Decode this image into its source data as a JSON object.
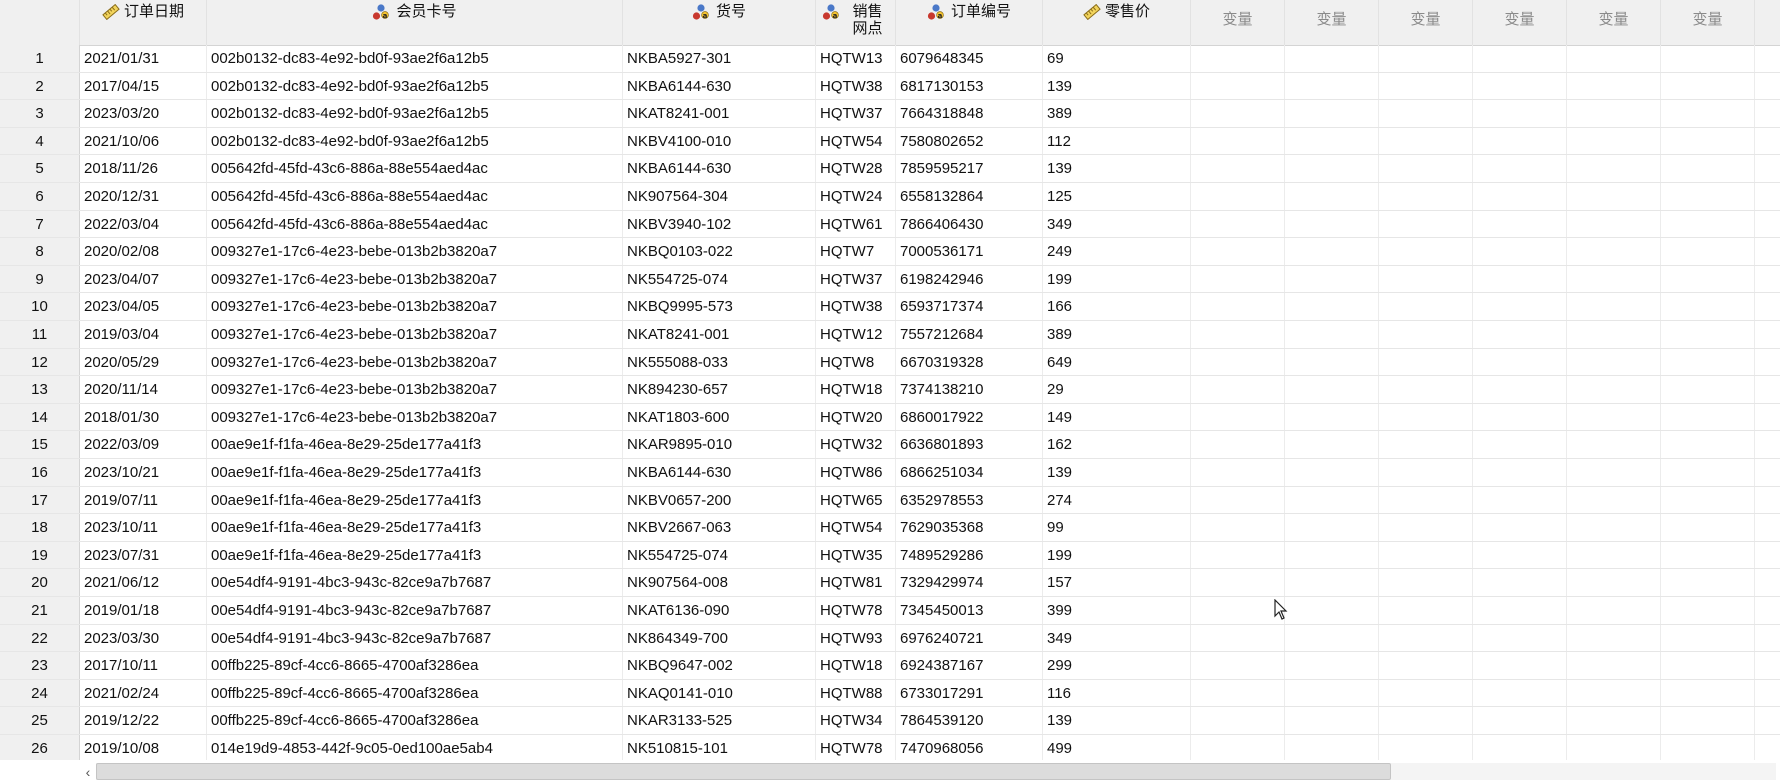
{
  "columns": [
    {
      "label": "订单日期",
      "icon": "ruler-icon"
    },
    {
      "label": "会员卡号",
      "icon": "nominal-string-icon"
    },
    {
      "label": "货号",
      "icon": "nominal-string-icon"
    },
    {
      "label": "销售网点",
      "icon": "nominal-string-icon"
    },
    {
      "label": "订单编号",
      "icon": "nominal-string-icon"
    },
    {
      "label": "零售价",
      "icon": "ruler-icon"
    },
    {
      "label": "变量"
    },
    {
      "label": "变量"
    },
    {
      "label": "变量"
    },
    {
      "label": "变量"
    },
    {
      "label": "变量"
    },
    {
      "label": "变量"
    }
  ],
  "rows": [
    {
      "n": "1",
      "date": "2021/01/31",
      "card": "002b0132-dc83-4e92-bd0f-93ae2f6a12b5",
      "sku": "NKBA5927-301",
      "store": "HQTW13",
      "order": "6079648345",
      "price": "69"
    },
    {
      "n": "2",
      "date": "2017/04/15",
      "card": "002b0132-dc83-4e92-bd0f-93ae2f6a12b5",
      "sku": "NKBA6144-630",
      "store": "HQTW38",
      "order": "6817130153",
      "price": "139"
    },
    {
      "n": "3",
      "date": "2023/03/20",
      "card": "002b0132-dc83-4e92-bd0f-93ae2f6a12b5",
      "sku": "NKAT8241-001",
      "store": "HQTW37",
      "order": "7664318848",
      "price": "389"
    },
    {
      "n": "4",
      "date": "2021/10/06",
      "card": "002b0132-dc83-4e92-bd0f-93ae2f6a12b5",
      "sku": "NKBV4100-010",
      "store": "HQTW54",
      "order": "7580802652",
      "price": "112"
    },
    {
      "n": "5",
      "date": "2018/11/26",
      "card": "005642fd-45fd-43c6-886a-88e554aed4ac",
      "sku": "NKBA6144-630",
      "store": "HQTW28",
      "order": "7859595217",
      "price": "139"
    },
    {
      "n": "6",
      "date": "2020/12/31",
      "card": "005642fd-45fd-43c6-886a-88e554aed4ac",
      "sku": "NK907564-304",
      "store": "HQTW24",
      "order": "6558132864",
      "price": "125"
    },
    {
      "n": "7",
      "date": "2022/03/04",
      "card": "005642fd-45fd-43c6-886a-88e554aed4ac",
      "sku": "NKBV3940-102",
      "store": "HQTW61",
      "order": "7866406430",
      "price": "349"
    },
    {
      "n": "8",
      "date": "2020/02/08",
      "card": "009327e1-17c6-4e23-bebe-013b2b3820a7",
      "sku": "NKBQ0103-022",
      "store": "HQTW7",
      "order": "7000536171",
      "price": "249"
    },
    {
      "n": "9",
      "date": "2023/04/07",
      "card": "009327e1-17c6-4e23-bebe-013b2b3820a7",
      "sku": "NK554725-074",
      "store": "HQTW37",
      "order": "6198242946",
      "price": "199"
    },
    {
      "n": "10",
      "date": "2023/04/05",
      "card": "009327e1-17c6-4e23-bebe-013b2b3820a7",
      "sku": "NKBQ9995-573",
      "store": "HQTW38",
      "order": "6593717374",
      "price": "166"
    },
    {
      "n": "11",
      "date": "2019/03/04",
      "card": "009327e1-17c6-4e23-bebe-013b2b3820a7",
      "sku": "NKAT8241-001",
      "store": "HQTW12",
      "order": "7557212684",
      "price": "389"
    },
    {
      "n": "12",
      "date": "2020/05/29",
      "card": "009327e1-17c6-4e23-bebe-013b2b3820a7",
      "sku": "NK555088-033",
      "store": "HQTW8",
      "order": "6670319328",
      "price": "649"
    },
    {
      "n": "13",
      "date": "2020/11/14",
      "card": "009327e1-17c6-4e23-bebe-013b2b3820a7",
      "sku": "NK894230-657",
      "store": "HQTW18",
      "order": "7374138210",
      "price": "29"
    },
    {
      "n": "14",
      "date": "2018/01/30",
      "card": "009327e1-17c6-4e23-bebe-013b2b3820a7",
      "sku": "NKAT1803-600",
      "store": "HQTW20",
      "order": "6860017922",
      "price": "149"
    },
    {
      "n": "15",
      "date": "2022/03/09",
      "card": "00ae9e1f-f1fa-46ea-8e29-25de177a41f3",
      "sku": "NKAR9895-010",
      "store": "HQTW32",
      "order": "6636801893",
      "price": "162"
    },
    {
      "n": "16",
      "date": "2023/10/21",
      "card": "00ae9e1f-f1fa-46ea-8e29-25de177a41f3",
      "sku": "NKBA6144-630",
      "store": "HQTW86",
      "order": "6866251034",
      "price": "139"
    },
    {
      "n": "17",
      "date": "2019/07/11",
      "card": "00ae9e1f-f1fa-46ea-8e29-25de177a41f3",
      "sku": "NKBV0657-200",
      "store": "HQTW65",
      "order": "6352978553",
      "price": "274"
    },
    {
      "n": "18",
      "date": "2023/10/11",
      "card": "00ae9e1f-f1fa-46ea-8e29-25de177a41f3",
      "sku": "NKBV2667-063",
      "store": "HQTW54",
      "order": "7629035368",
      "price": "99"
    },
    {
      "n": "19",
      "date": "2023/07/31",
      "card": "00ae9e1f-f1fa-46ea-8e29-25de177a41f3",
      "sku": "NK554725-074",
      "store": "HQTW35",
      "order": "7489529286",
      "price": "199"
    },
    {
      "n": "20",
      "date": "2021/06/12",
      "card": "00e54df4-9191-4bc3-943c-82ce9a7b7687",
      "sku": "NK907564-008",
      "store": "HQTW81",
      "order": "7329429974",
      "price": "157"
    },
    {
      "n": "21",
      "date": "2019/01/18",
      "card": "00e54df4-9191-4bc3-943c-82ce9a7b7687",
      "sku": "NKAT6136-090",
      "store": "HQTW78",
      "order": "7345450013",
      "price": "399"
    },
    {
      "n": "22",
      "date": "2023/03/30",
      "card": "00e54df4-9191-4bc3-943c-82ce9a7b7687",
      "sku": "NK864349-700",
      "store": "HQTW93",
      "order": "6976240721",
      "price": "349"
    },
    {
      "n": "23",
      "date": "2017/10/11",
      "card": "00ffb225-89cf-4cc6-8665-4700af3286ea",
      "sku": "NKBQ9647-002",
      "store": "HQTW18",
      "order": "6924387167",
      "price": "299"
    },
    {
      "n": "24",
      "date": "2021/02/24",
      "card": "00ffb225-89cf-4cc6-8665-4700af3286ea",
      "sku": "NKAQ0141-010",
      "store": "HQTW88",
      "order": "6733017291",
      "price": "116"
    },
    {
      "n": "25",
      "date": "2019/12/22",
      "card": "00ffb225-89cf-4cc6-8665-4700af3286ea",
      "sku": "NKAR3133-525",
      "store": "HQTW34",
      "order": "7864539120",
      "price": "139"
    },
    {
      "n": "26",
      "date": "2019/10/08",
      "card": "014e19d9-4853-442f-9c05-0ed100ae5ab4",
      "sku": "NK510815-101",
      "store": "HQTW78",
      "order": "7470968056",
      "price": "499"
    }
  ],
  "scrollbar": {
    "left_arrow": "‹"
  }
}
